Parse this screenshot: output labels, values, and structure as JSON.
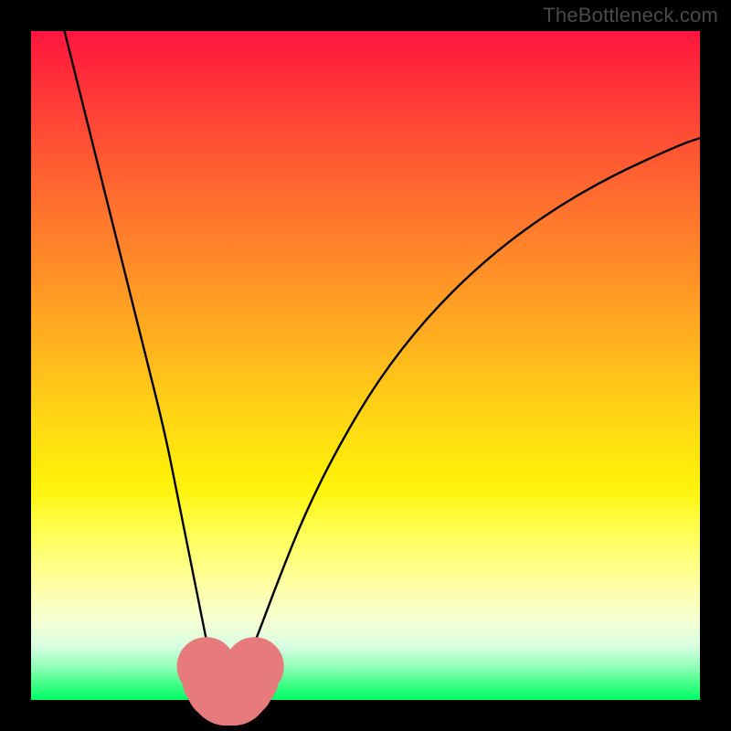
{
  "watermark": "TheBottleneck.com",
  "colors": {
    "frame": "#000000",
    "curve": "#000000",
    "marker_fill": "#e77a7a",
    "marker_stroke": "#c85b5b",
    "gradient_top": "#ff153f",
    "gradient_bottom": "#00ff66"
  },
  "chart_data": {
    "type": "line",
    "title": "",
    "xlabel": "",
    "ylabel": "",
    "xlim": [
      0,
      100
    ],
    "ylim": [
      0,
      100
    ],
    "grid": false,
    "legend": false,
    "series": [
      {
        "name": "bottleneck-curve",
        "x": [
          5,
          8,
          11,
          14,
          17,
          20,
          22,
          24,
          26,
          27,
          28,
          29,
          30,
          31,
          32,
          34,
          37,
          41,
          46,
          52,
          59,
          67,
          76,
          86,
          97,
          100
        ],
        "y": [
          100,
          88,
          76,
          64,
          52,
          40,
          30,
          20,
          10,
          5,
          2.5,
          1.5,
          1.5,
          2.5,
          5,
          10,
          18,
          28,
          38,
          48,
          57,
          65,
          72,
          78,
          83,
          84
        ]
      }
    ],
    "markers": {
      "name": "trough-markers",
      "x": [
        26.2,
        27.4,
        28.3,
        29.2,
        30.2,
        31.2,
        32.2,
        33.4
      ],
      "y": [
        5.0,
        3.0,
        2.0,
        1.6,
        1.6,
        2.2,
        3.2,
        5.0
      ],
      "size": [
        5.5,
        6.0,
        6.4,
        6.8,
        6.8,
        6.4,
        6.0,
        5.5
      ]
    }
  }
}
